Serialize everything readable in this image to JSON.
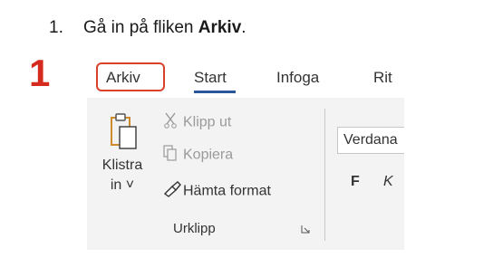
{
  "instruction": {
    "number": "1.",
    "text_before": "Gå in på fliken ",
    "emphasis": "Arkiv",
    "text_after": "."
  },
  "callout_number": "1",
  "ribbon": {
    "tabs": {
      "file": "Arkiv",
      "home": "Start",
      "insert": "Infoga",
      "draw": "Rit"
    },
    "clipboard": {
      "paste_line1": "Klistra",
      "paste_line2": "in ˅",
      "cut": "Klipp ut",
      "copy": "Kopiera",
      "format_painter": "Hämta format",
      "group_label": "Urklipp"
    },
    "font": {
      "font_name": "Verdana",
      "bold": "F",
      "italic": "K"
    }
  },
  "colors": {
    "callout": "#d52b1e",
    "highlight_border": "#d9412b",
    "active_tab_underline": "#2b579a",
    "ribbon_background": "#f3f3f3"
  }
}
